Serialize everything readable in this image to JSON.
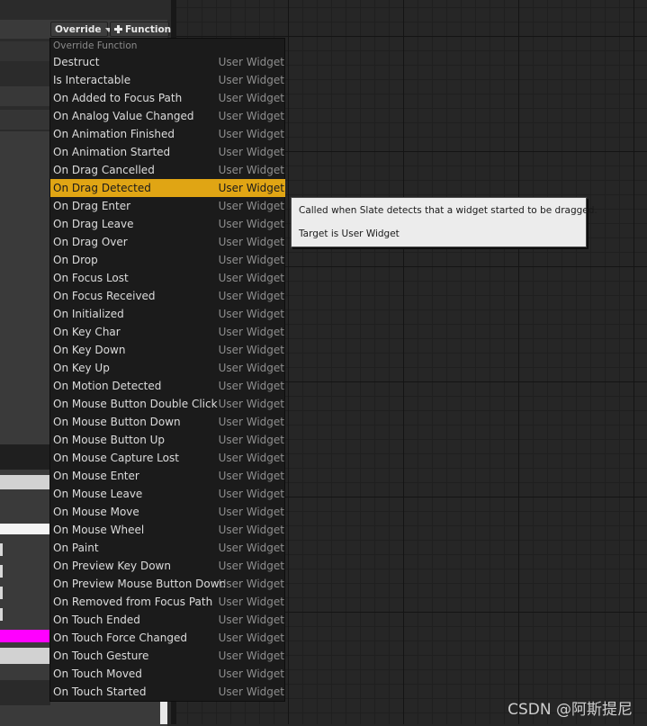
{
  "header": {
    "override_label": "Override",
    "add_function_label": "Function"
  },
  "menu": {
    "header": "Override Function",
    "items": [
      {
        "label": "Destruct",
        "category": "User Widget"
      },
      {
        "label": "Is Interactable",
        "category": "User Widget"
      },
      {
        "label": "On Added to Focus Path",
        "category": "User Widget"
      },
      {
        "label": "On Analog Value Changed",
        "category": "User Widget"
      },
      {
        "label": "On Animation Finished",
        "category": "User Widget"
      },
      {
        "label": "On Animation Started",
        "category": "User Widget"
      },
      {
        "label": "On Drag Cancelled",
        "category": "User Widget"
      },
      {
        "label": "On Drag Detected",
        "category": "User Widget",
        "selected": true
      },
      {
        "label": "On Drag Enter",
        "category": "User Widget"
      },
      {
        "label": "On Drag Leave",
        "category": "User Widget"
      },
      {
        "label": "On Drag Over",
        "category": "User Widget"
      },
      {
        "label": "On Drop",
        "category": "User Widget"
      },
      {
        "label": "On Focus Lost",
        "category": "User Widget"
      },
      {
        "label": "On Focus Received",
        "category": "User Widget"
      },
      {
        "label": "On Initialized",
        "category": "User Widget"
      },
      {
        "label": "On Key Char",
        "category": "User Widget"
      },
      {
        "label": "On Key Down",
        "category": "User Widget"
      },
      {
        "label": "On Key Up",
        "category": "User Widget"
      },
      {
        "label": "On Motion Detected",
        "category": "User Widget"
      },
      {
        "label": "On Mouse Button Double Click",
        "category": "User Widget"
      },
      {
        "label": "On Mouse Button Down",
        "category": "User Widget"
      },
      {
        "label": "On Mouse Button Up",
        "category": "User Widget"
      },
      {
        "label": "On Mouse Capture Lost",
        "category": "User Widget"
      },
      {
        "label": "On Mouse Enter",
        "category": "User Widget"
      },
      {
        "label": "On Mouse Leave",
        "category": "User Widget"
      },
      {
        "label": "On Mouse Move",
        "category": "User Widget"
      },
      {
        "label": "On Mouse Wheel",
        "category": "User Widget"
      },
      {
        "label": "On Paint",
        "category": "User Widget"
      },
      {
        "label": "On Preview Key Down",
        "category": "User Widget"
      },
      {
        "label": "On Preview Mouse Button Down",
        "category": "User Widget"
      },
      {
        "label": "On Removed from Focus Path",
        "category": "User Widget"
      },
      {
        "label": "On Touch Ended",
        "category": "User Widget"
      },
      {
        "label": "On Touch Force Changed",
        "category": "User Widget"
      },
      {
        "label": "On Touch Gesture",
        "category": "User Widget"
      },
      {
        "label": "On Touch Moved",
        "category": "User Widget"
      },
      {
        "label": "On Touch Started",
        "category": "User Widget"
      }
    ]
  },
  "tooltip": {
    "description": "Called when Slate detects that a widget started to be dragged.",
    "target": "Target is User Widget"
  },
  "watermark": "CSDN @阿斯提尼",
  "colors": {
    "selection": "#e0a514",
    "menu_background": "#1b1b1b",
    "tooltip_background": "#ececec",
    "magenta_swatch": "#ff00ff"
  }
}
